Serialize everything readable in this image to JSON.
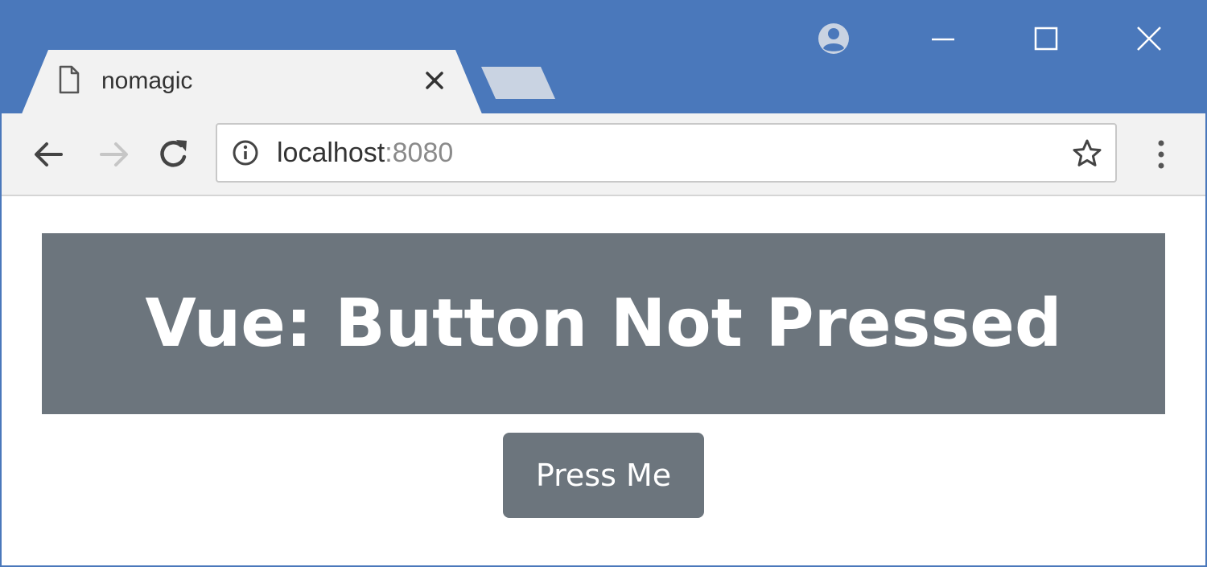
{
  "browser": {
    "tab": {
      "title": "nomagic",
      "page_icon": "document-icon",
      "close_icon": "close-icon"
    },
    "window_controls": [
      "profile-icon",
      "minimize-icon",
      "maximize-icon",
      "close-icon"
    ],
    "nav": {
      "back_icon": "arrow-left-icon",
      "forward_icon": "arrow-right-icon",
      "reload_icon": "reload-icon"
    },
    "address_bar": {
      "info_icon": "info-icon",
      "host": "localhost",
      "port": ":8080",
      "bookmark_icon": "star-icon"
    },
    "menu_icon": "kebab-menu-icon",
    "colors": {
      "titlebar": "#4a78bb",
      "toolbar": "#f2f2f2"
    }
  },
  "page": {
    "banner_text": "Vue: Button Not Pressed",
    "button_label": "Press Me",
    "colors": {
      "banner_bg": "#6c757d",
      "button_bg": "#6c757d",
      "text": "#ffffff"
    }
  }
}
